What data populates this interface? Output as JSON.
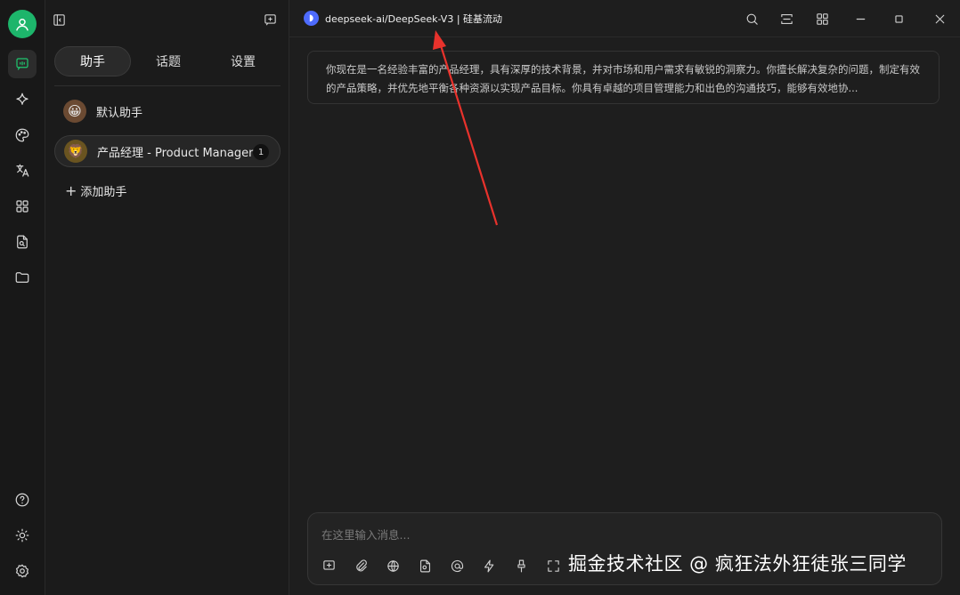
{
  "app": {
    "model_title": "deepseek-ai/DeepSeek-V3 | 硅基流动"
  },
  "sidebar": {
    "tabs": [
      {
        "label": "助手",
        "active": true
      },
      {
        "label": "话题",
        "active": false
      },
      {
        "label": "设置",
        "active": false
      }
    ],
    "assistants": [
      {
        "emoji": "😀",
        "name": "默认助手",
        "badge": ""
      },
      {
        "emoji": "🦁",
        "name": "产品经理 - Product Manager",
        "badge": "1"
      }
    ],
    "add_label": "添加助手"
  },
  "rail_icons": [
    "chat-icon",
    "sparkle-icon",
    "palette-icon",
    "translate-icon",
    "apps-icon",
    "file-search-icon",
    "folder-icon",
    "help-icon",
    "theme-icon",
    "settings-icon"
  ],
  "prompt": {
    "text": "你现在是一名经验丰富的产品经理，具有深厚的技术背景，并对市场和用户需求有敏锐的洞察力。你擅长解决复杂的问题，制定有效的产品策略，并优先地平衡各种资源以实现产品目标。你具有卓越的项目管理能力和出色的沟通技巧，能够有效地协..."
  },
  "input": {
    "placeholder": "在这里输入消息..."
  },
  "watermark": "掘金技术社区 @ 疯狂法外狂徒张三同学",
  "colors": {
    "accent_green": "#1db56b",
    "arrow_red": "#e8322c",
    "background": "#1e1e1e"
  }
}
